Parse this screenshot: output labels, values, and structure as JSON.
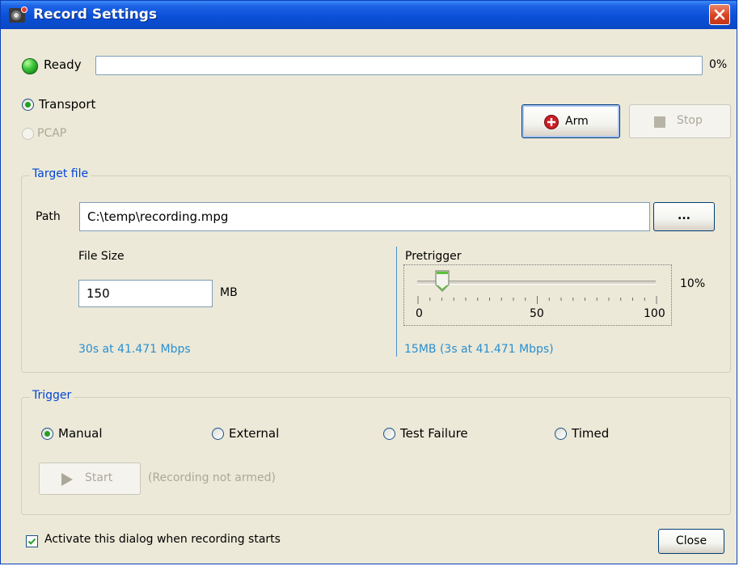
{
  "window": {
    "title": "Record Settings"
  },
  "status": {
    "text": "Ready",
    "progress_percent": 0,
    "progress_label": "0%"
  },
  "mode": {
    "transport_label": "Transport",
    "pcap_label": "PCAP",
    "selected": "Transport"
  },
  "controls": {
    "arm_label": "Arm",
    "stop_label": "Stop"
  },
  "target_file": {
    "title": "Target file",
    "path_label": "Path",
    "path_value": "C:\\temp\\recording.mpg",
    "browse_label": "...",
    "file_size_label": "File Size",
    "file_size_value": "150",
    "file_size_unit": "MB",
    "file_size_info": "30s at 41.471 Mbps",
    "pretrigger_label": "Pretrigger",
    "pretrigger_percent": 10,
    "pretrigger_value_label": "10%",
    "pretrigger_scale": [
      "0",
      "50",
      "100"
    ],
    "pretrigger_info": "15MB (3s at 41.471 Mbps)"
  },
  "trigger": {
    "title": "Trigger",
    "options": [
      "Manual",
      "External",
      "Test Failure",
      "Timed"
    ],
    "selected": "Manual",
    "start_label": "Start",
    "status_text": "(Recording not armed)"
  },
  "footer": {
    "activate_label": "Activate this dialog when recording starts",
    "activate_checked": true,
    "close_label": "Close"
  },
  "colors": {
    "title_bar": "#0a50d8",
    "accent_link": "#2a8fd0",
    "group_title": "#0046d5",
    "arm_red": "#cc1f24",
    "ready_green": "#3bc43a"
  }
}
